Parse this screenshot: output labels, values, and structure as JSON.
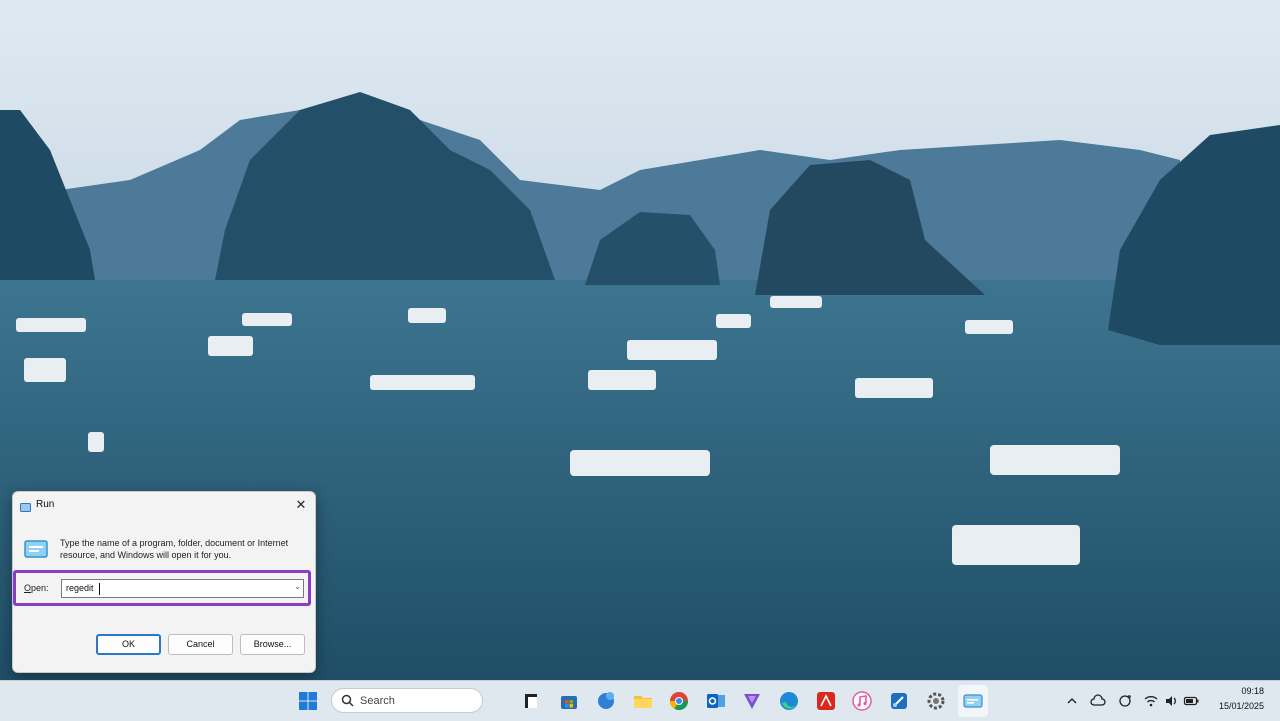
{
  "desktop": {
    "wallpaper_desc_icon": "landscape-wallpaper"
  },
  "run_dialog": {
    "title": "Run",
    "description": "Type the name of a program, folder, document or Internet resource, and Windows will open it for you.",
    "open_label_accel": "O",
    "open_label_rest": "pen:",
    "open_value": "regedit",
    "ok_label": "OK",
    "cancel_label": "Cancel",
    "browse_label": "Browse...",
    "close_glyph": "✕",
    "highlight_color": "#8a3dc4"
  },
  "taskbar": {
    "search_placeholder": "Search",
    "pinned": [
      "start-icon",
      "task-view-icon",
      "store-icon",
      "copilot-icon",
      "file-explorer-icon",
      "chrome-icon",
      "outlook-icon",
      "feedback-icon",
      "edge-icon",
      "acrobat-icon",
      "itunes-icon",
      "snipping-tool-icon",
      "settings-icon",
      "run-app-icon"
    ],
    "tray": [
      "chevron-up-icon",
      "cloud-icon",
      "sync-icon",
      "wifi-icon",
      "volume-icon",
      "battery-icon"
    ],
    "clock_time": "09:18",
    "clock_date": "15/01/2025"
  }
}
